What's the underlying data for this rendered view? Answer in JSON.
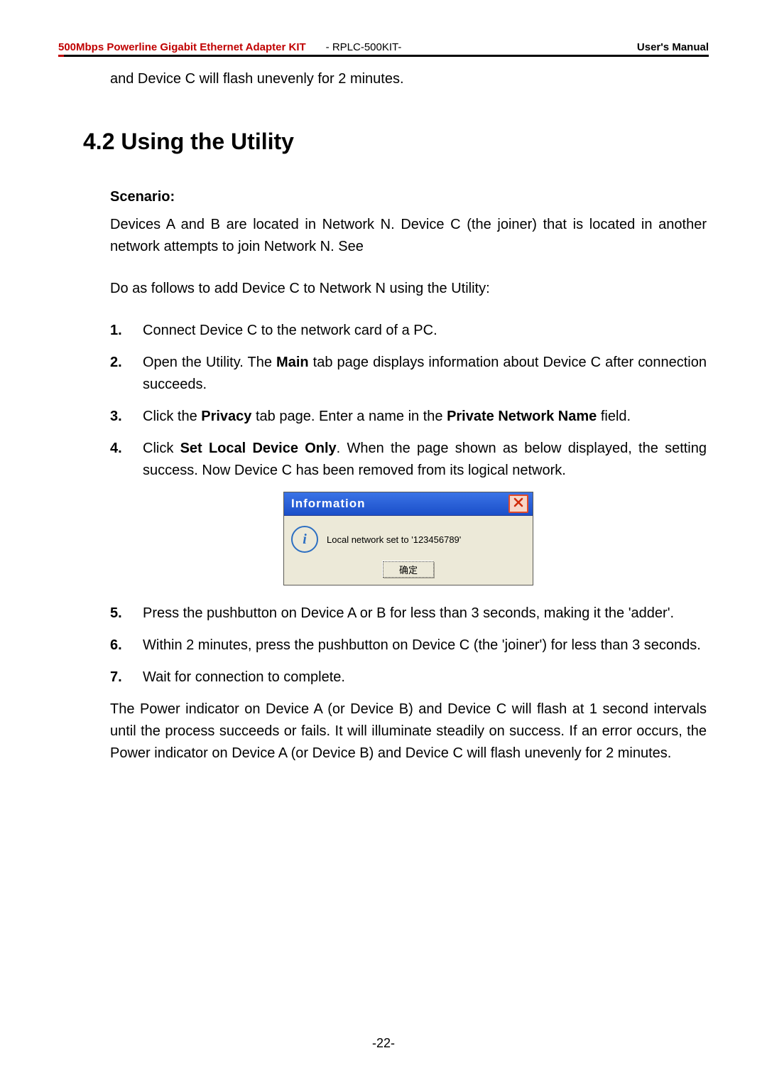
{
  "header": {
    "left": "500Mbps Powerline Gigabit Ethernet Adapter KIT",
    "mid": "- RPLC-500KIT-",
    "right": "User's Manual"
  },
  "intro_carry": "and Device C will flash unevenly for 2 minutes.",
  "section_title": "4.2 Using the Utility",
  "scenario_label": "Scenario:",
  "scenario_text": "Devices A and B are located in Network N. Device C (the joiner) that is located in another network attempts to join Network N. See",
  "lead_in": "Do as follows to add Device C to Network N using the Utility:",
  "steps": {
    "s1": {
      "num": "1.",
      "text": "Connect Device C to the network card of a PC."
    },
    "s2": {
      "num": "2.",
      "a": "Open the Utility. The ",
      "b": "Main",
      "c": " tab page displays information about Device C after connection succeeds."
    },
    "s3": {
      "num": "3.",
      "a": "Click the ",
      "b": "Privacy",
      "c": " tab page. Enter a name in the ",
      "d": "Private Network Name",
      "e": " field."
    },
    "s4": {
      "num": "4.",
      "a": "Click ",
      "b": "Set Local Device Only",
      "c": ". When the page shown as below displayed, the setting success. Now Device C has been removed from its logical network."
    },
    "s5": {
      "num": "5.",
      "text": "Press the pushbutton on Device A or B for less than 3 seconds, making it the 'adder'."
    },
    "s6": {
      "num": "6.",
      "text": "Within 2 minutes, press the pushbutton on Device C (the 'joiner') for less than 3 seconds."
    },
    "s7": {
      "num": "7.",
      "text": "Wait for connection to complete."
    }
  },
  "dialog": {
    "title": "Information",
    "message": "Local network set to '123456789'",
    "ok_label": "确定"
  },
  "closing": "The Power indicator on Device A (or Device B) and Device C will flash at 1 second intervals until the process succeeds or fails. It will illuminate steadily on success. If an error occurs, the Power indicator on Device A (or Device B) and Device C will flash unevenly for 2 minutes.",
  "page_number": "-22-"
}
